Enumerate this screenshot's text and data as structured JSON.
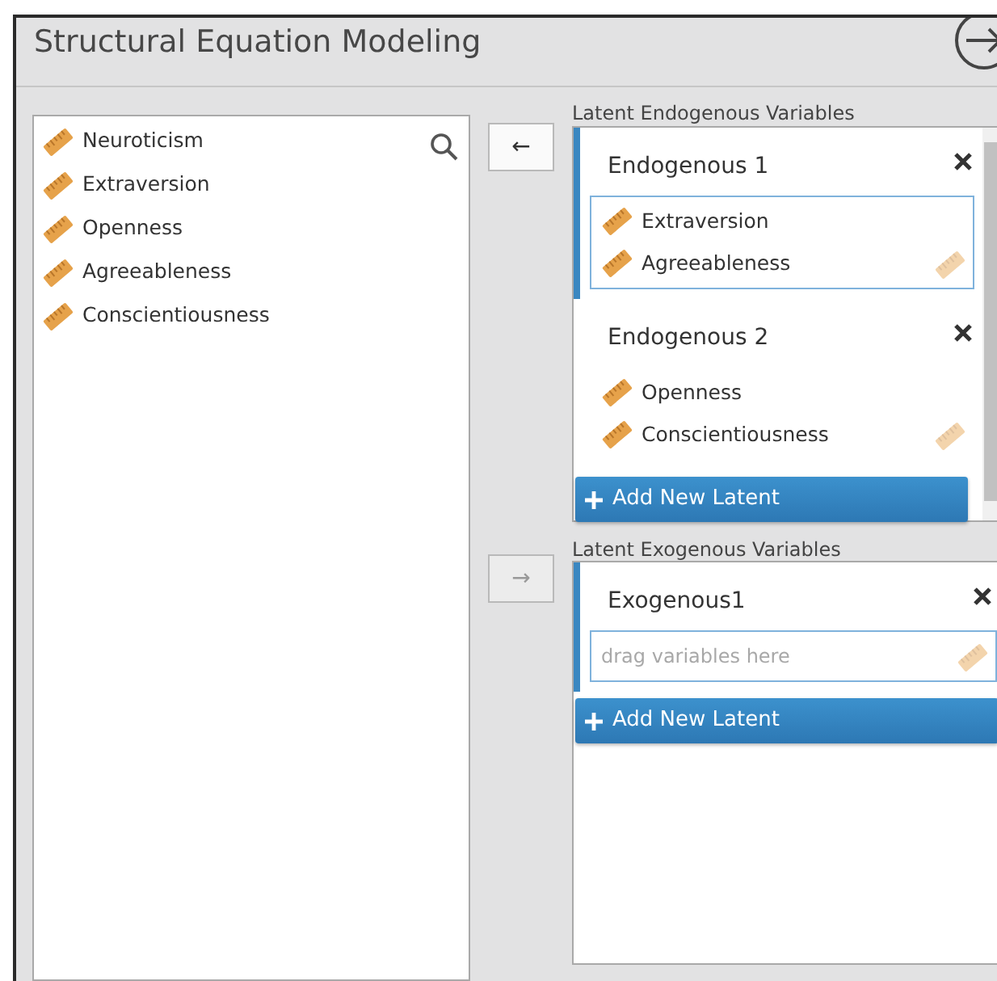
{
  "window": {
    "title": "Structural Equation Modeling"
  },
  "variables": [
    {
      "name": "Neuroticism"
    },
    {
      "name": "Extraversion"
    },
    {
      "name": "Openness"
    },
    {
      "name": "Agreeableness"
    },
    {
      "name": "Conscientiousness"
    }
  ],
  "transfer_buttons": [
    {
      "symbol": "←",
      "disabled": false
    },
    {
      "symbol": "→",
      "disabled": true
    }
  ],
  "endogenous": {
    "label": "Latent Endogenous Variables",
    "add_button": "Add New Latent",
    "latents": [
      {
        "name": "Endogenous 1",
        "selected": true,
        "variables": [
          "Extraversion",
          "Agreeableness"
        ]
      },
      {
        "name": "Endogenous 2",
        "selected": false,
        "variables": [
          "Openness",
          "Conscientiousness"
        ]
      }
    ]
  },
  "exogenous": {
    "label": "Latent Exogenous Variables",
    "add_button": "Add New Latent",
    "latents": [
      {
        "name": "Exogenous1",
        "selected": true,
        "placeholder": "drag variables here"
      }
    ]
  }
}
